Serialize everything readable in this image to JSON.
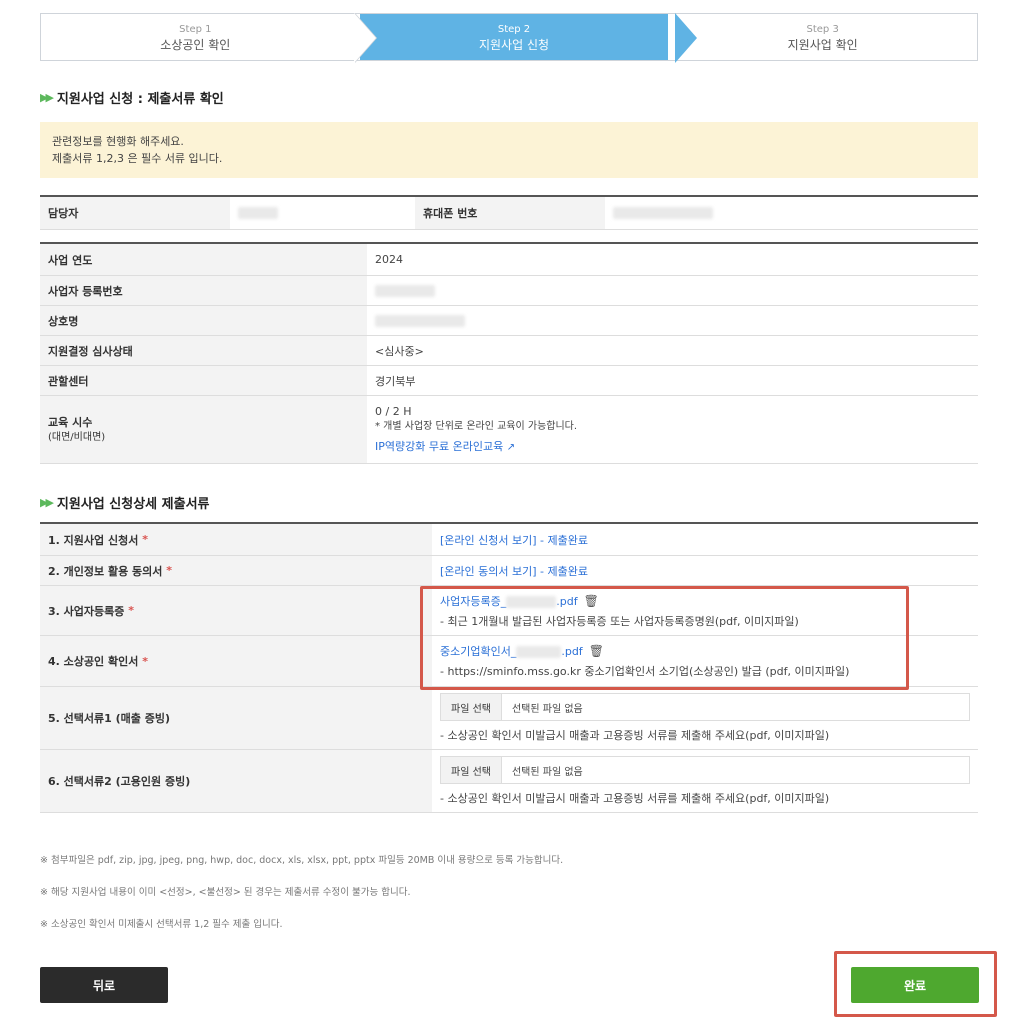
{
  "steps": [
    {
      "num": "Step 1",
      "title": "소상공인 확인"
    },
    {
      "num": "Step 2",
      "title": "지원사업 신청"
    },
    {
      "num": "Step 3",
      "title": "지원사업 확인"
    }
  ],
  "section1_title": "지원사업 신청 : 제출서류 확인",
  "notice": {
    "line1": "관련정보를 현행화 해주세요.",
    "line2": "제출서류 1,2,3 은 필수 서류 입니다."
  },
  "contact": {
    "manager_label": "담당자",
    "phone_label": "휴대폰 번호"
  },
  "info": {
    "year_label": "사업 연도",
    "year_value": "2024",
    "bizno_label": "사업자 등록번호",
    "company_label": "상호명",
    "status_label": "지원결정 심사상태",
    "status_value": "<심사중>",
    "center_label": "관할센터",
    "center_value": "경기북부",
    "edu_label_1": "교육 시수",
    "edu_label_2": "(대면/비대면)",
    "edu_hours": "0 / 2 H",
    "edu_note": "* 개별 사업장 단위로 온라인 교육이 가능합니다.",
    "edu_link": "IP역량강화 무료 온라인교육"
  },
  "section2_title": "지원사업 신청상세 제출서류",
  "docs": [
    {
      "label": "1. 지원사업 신청서",
      "req": "*",
      "link": "[온라인 신청서 보기] - 제출완료"
    },
    {
      "label": "2. 개인정보 활용 동의서",
      "req": "*",
      "link": "[온라인 동의서 보기] - 제출완료"
    },
    {
      "label": "3. 사업자등록증",
      "req": "*",
      "file_prefix": "사업자등록증_",
      "file_ext": ".pdf",
      "hint": "- 최근 1개월내 발급된 사업자등록증 또는 사업자등록증명원(pdf, 이미지파일)"
    },
    {
      "label": "4. 소상공인 확인서",
      "req": "*",
      "file_prefix": "중소기업확인서_",
      "file_ext": ".pdf",
      "hint": "- https://sminfo.mss.go.kr 중소기업확인서 소기업(소상공인) 발급 (pdf, 이미지파일)"
    },
    {
      "label": "5. 선택서류1 (매출 증빙)",
      "btn": "파일 선택",
      "file_status": "선택된 파일 없음",
      "hint": "- 소상공인 확인서 미발급시 매출과 고용증빙 서류를 제출해 주세요(pdf, 이미지파일)"
    },
    {
      "label": "6. 선택서류2 (고용인원 증빙)",
      "btn": "파일 선택",
      "file_status": "선택된 파일 없음",
      "hint": "- 소상공인 확인서 미발급시 매출과 고용증빙 서류를 제출해 주세요(pdf, 이미지파일)"
    }
  ],
  "notes": [
    "※ 첨부파일은 pdf, zip, jpg, jpeg, png, hwp, doc, docx, xls, xlsx, ppt, pptx 파일등 20MB 이내 용량으로 등록 가능합니다.",
    "※ 해당 지원사업 내용이 이미 <선정>, <불선정> 된 경우는 제출서류 수정이 불가능 합니다.",
    "※ 소상공인 확인서 미제출시 선택서류 1,2 필수 제출 입니다."
  ],
  "buttons": {
    "back": "뒤로",
    "done": "완료"
  },
  "colors": {
    "active_step": "#5fb3e4",
    "done_button": "#4ea82f",
    "highlight": "#d4584a"
  }
}
